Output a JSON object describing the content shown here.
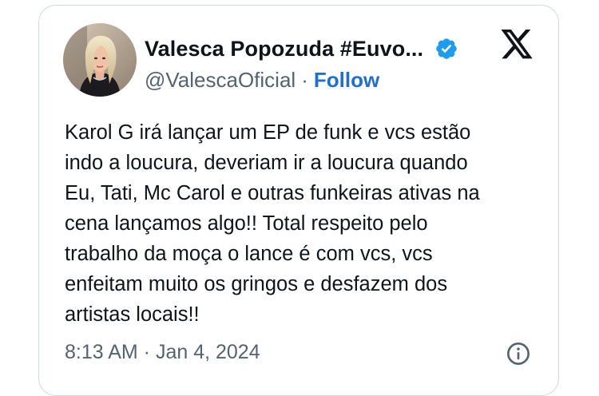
{
  "tweet": {
    "author": {
      "display_name": "Valesca Popozuda #Euvo...",
      "handle": "@ValescaOficial",
      "separator": "·",
      "follow_label": "Follow",
      "avatar_icon": "profile-photo",
      "verified_icon": "verified-badge-icon"
    },
    "platform_icon": "x-logo-icon",
    "text": "Karol G irá lançar um EP de funk e vcs estão\nindo a loucura, deveriam ir a loucura quando\nEu, Tati, Mc Carol e outras funkeiras ativas na\ncena lançamos algo!! Total respeito pelo\ntrabalho da moça o lance é com vcs, vcs\nenfeitam muito os gringos e desfazem dos\nartistas locais!!",
    "timestamp": "8:13 AM · Jan 4, 2024",
    "info_icon": "info-icon"
  },
  "colors": {
    "text_primary": "#0f1419",
    "text_secondary": "#536471",
    "accent": "#1d6fd6",
    "verified": "#1d9bf0",
    "border": "#cfd9de"
  }
}
